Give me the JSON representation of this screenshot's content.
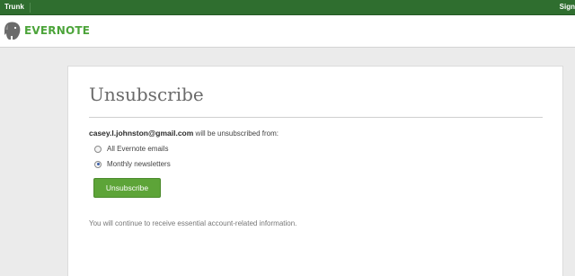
{
  "topbar": {
    "left_label": "Trunk",
    "right_label": "Sign"
  },
  "header": {
    "brand": "EVERNOTE"
  },
  "page": {
    "title": "Unsubscribe",
    "email": "casey.l.johnston@gmail.com",
    "intro_suffix": " will be unsubscribed from:",
    "options": [
      {
        "label": "All Evernote emails",
        "selected": false
      },
      {
        "label": "Monthly newsletters",
        "selected": true
      }
    ],
    "button_label": "Unsubscribe",
    "note": "You will continue to receive essential account-related information."
  },
  "colors": {
    "topbar": "#2f6e2f",
    "brand": "#4ca43a",
    "button": "#5da438"
  },
  "icons": [
    "elephant-logo-icon",
    "radio-unselected",
    "radio-selected"
  ]
}
